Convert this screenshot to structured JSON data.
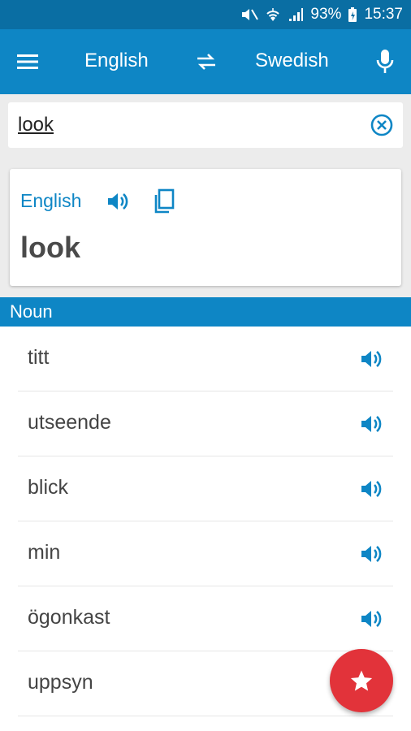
{
  "status_bar": {
    "battery_percent": "93%",
    "time": "15:37",
    "icons": [
      "mute-icon",
      "wifi-icon",
      "signal-icon",
      "battery-charging-icon"
    ]
  },
  "app_bar": {
    "from_language": "English",
    "to_language": "Swedish",
    "icons": [
      "menu-icon",
      "swap-icon",
      "microphone-icon"
    ]
  },
  "search": {
    "value": "look"
  },
  "source_card": {
    "language": "English",
    "word": "look"
  },
  "section": {
    "part_of_speech": "Noun"
  },
  "translations": [
    {
      "word": "titt"
    },
    {
      "word": "utseende"
    },
    {
      "word": "blick"
    },
    {
      "word": "min"
    },
    {
      "word": "ögonkast"
    },
    {
      "word": "uppsyn"
    }
  ],
  "colors": {
    "primary": "#0e86c5",
    "status_bar": "#0a6ea3",
    "fab": "#e2333a"
  }
}
